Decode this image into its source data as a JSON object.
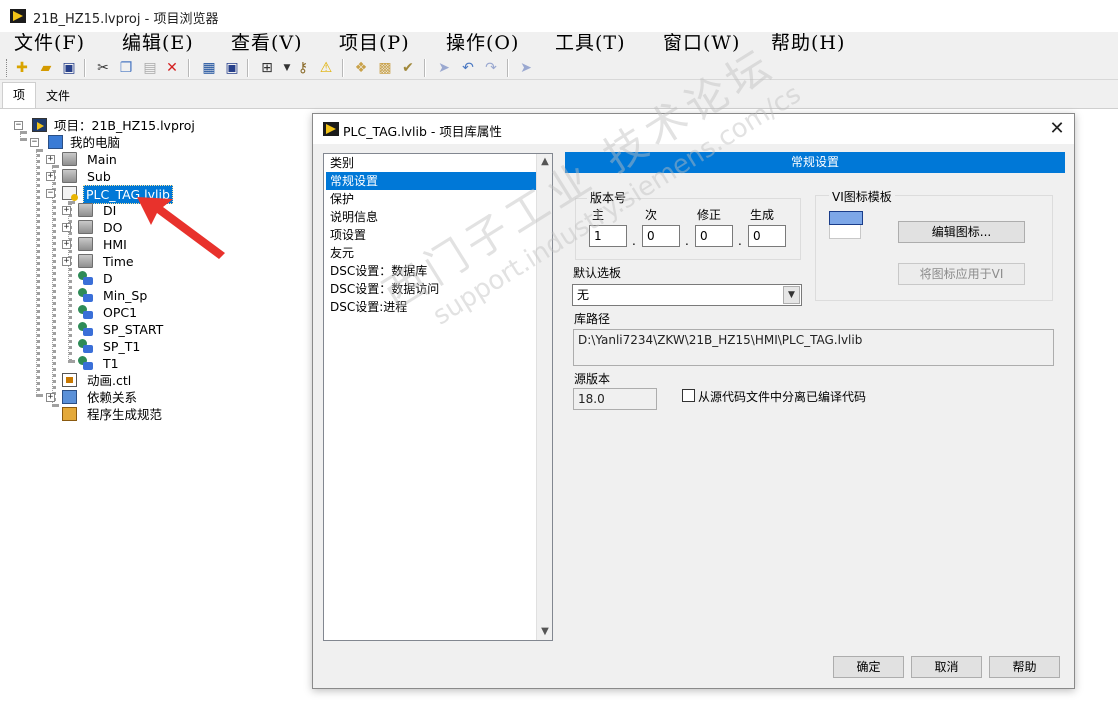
{
  "window": {
    "title": "21B_HZ15.lvproj - 项目浏览器"
  },
  "menu": [
    {
      "label": "文件(F)"
    },
    {
      "label": "编辑(E)"
    },
    {
      "label": "查看(V)"
    },
    {
      "label": "项目(P)"
    },
    {
      "label": "操作(O)"
    },
    {
      "label": "工具(T)"
    },
    {
      "label": "窗口(W)"
    },
    {
      "label": "帮助(H)"
    }
  ],
  "toolbar": {
    "icons": [
      "new-file-icon",
      "open-folder-icon",
      "save-all-icon",
      "cut-icon",
      "copy-icon",
      "paste-icon",
      "delete-icon",
      "build-icon",
      "save-icon",
      "view-icon",
      "dropdown-icon",
      "key-icon",
      "warning-icon",
      "library-add-icon",
      "library-icon",
      "library-check-icon",
      "run-icon",
      "undo-icon",
      "redo-icon",
      "help-icon"
    ]
  },
  "tabs": {
    "items": "项",
    "files": "文件"
  },
  "tree": {
    "project": "项目：21B_HZ15.lvproj",
    "my_computer": "我的电脑",
    "main": "Main",
    "sub": "Sub",
    "plc_tag": "PLC_TAG.lvlib",
    "di": "DI",
    "do": "DO",
    "hmi": "HMI",
    "time": "Time",
    "d": "D",
    "min_sp": "Min_Sp",
    "opc1": "OPC1",
    "sp_start": "SP_START",
    "sp_t1": "SP_T1",
    "t1": "T1",
    "animation": "动画.ctl",
    "dependencies": "依赖关系",
    "build_specs": "程序生成规范"
  },
  "dialog": {
    "title": "PLC_TAG.lvlib  - 项目库属性",
    "category_header": "类别",
    "categories": [
      {
        "label": "常规设置",
        "selected": true
      },
      {
        "label": "保护"
      },
      {
        "label": "说明信息"
      },
      {
        "label": "项设置"
      },
      {
        "label": "友元"
      },
      {
        "label": "DSC设置：数据库"
      },
      {
        "label": "DSC设置：数据访问"
      },
      {
        "label": "DSC设置:进程"
      }
    ],
    "panel_title": "常规设置",
    "version": {
      "group": "版本号",
      "major_label": "主",
      "minor_label": "次",
      "fix_label": "修正",
      "build_label": "生成",
      "major": "1",
      "minor": "0",
      "fix": "0",
      "build": "0",
      "separator": "."
    },
    "icon_template": {
      "group": "VI图标模板",
      "edit_button": "编辑图标...",
      "apply_button": "将图标应用于VI"
    },
    "default_palette": {
      "label": "默认选板",
      "value": "无"
    },
    "library_path": {
      "label": "库路径",
      "value": "D:\\Yanli7234\\ZKW\\21B_HZ15\\HMI\\PLC_TAG.lvlib"
    },
    "source_version": {
      "label": "源版本",
      "value": "18.0"
    },
    "separate_compiled": {
      "label": "从源代码文件中分离已编译代码",
      "checked": false
    },
    "buttons": {
      "ok": "确定",
      "cancel": "取消",
      "help": "帮助"
    }
  },
  "watermark": {
    "line1": "西门子工业  技术论坛",
    "line2": "support.industry.siemens.com/cs"
  },
  "colors": {
    "selection": "#0078d7",
    "annotation_arrow": "#e8322c"
  }
}
